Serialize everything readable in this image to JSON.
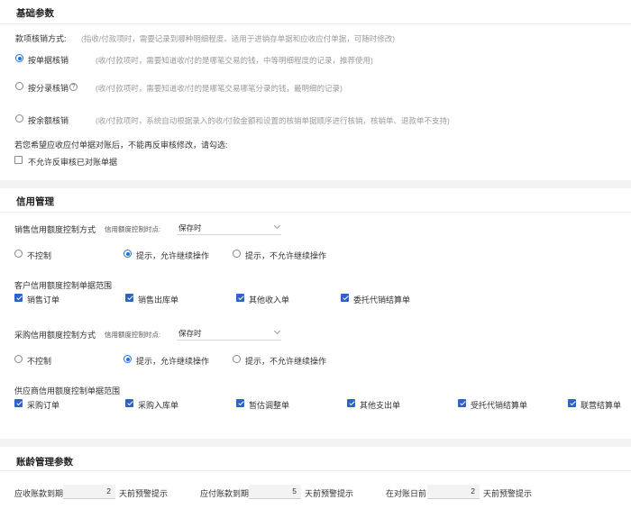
{
  "basic": {
    "title": "基础参数",
    "method_label": "款项核销方式:",
    "method_hint": "(指收/付款项时，需要记录到哪种明细程度。适用于进销存单据和应收应付单据，可随时修改)",
    "options": [
      {
        "label": "按单据核销",
        "desc": "(收/付款项时，需要知道收/付的是哪笔交易的钱，中等明细程度的记录，推荐使用)",
        "selected": true
      },
      {
        "label": "按分录核销",
        "desc": "(收/付款项时，需要知道收/付的是哪笔交易哪笔分录的钱，最明细的记录)",
        "selected": false
      },
      {
        "label": "按余额核销",
        "desc": "(收/付款项时，系统自动根据录入的收/付款金额和设置的核销单据顺序进行核销，核销单、退款单不支持)",
        "selected": false
      }
    ],
    "notice": "若您希望应收应付单据对账后，不能再反审核修改，请勾选:",
    "lock_label": "不允许反审核已对账单据",
    "help_glyph": "?"
  },
  "credit": {
    "title": "信用管理",
    "sales": {
      "label": "销售信用额度控制方式",
      "point_label": "信用额度控制时点:",
      "point_value": "保存时",
      "options": [
        {
          "label": "不控制",
          "selected": false
        },
        {
          "label": "提示，允许继续操作",
          "selected": true
        },
        {
          "label": "提示，不允许继续操作",
          "selected": false
        }
      ],
      "scope_label": "客户信用额度控制单据范围",
      "docs": [
        {
          "label": "销售订单",
          "checked": true
        },
        {
          "label": "销售出库单",
          "checked": true
        },
        {
          "label": "其他收入单",
          "checked": true
        },
        {
          "label": "委托代销结算单",
          "checked": true
        }
      ]
    },
    "purchase": {
      "label": "采购信用额度控制方式",
      "point_label": "信用额度控制时点:",
      "point_value": "保存时",
      "options": [
        {
          "label": "不控制",
          "selected": false
        },
        {
          "label": "提示，允许继续操作",
          "selected": true
        },
        {
          "label": "提示，不允许继续操作",
          "selected": false
        }
      ],
      "scope_label": "供应商信用额度控制单据范围",
      "docs": [
        {
          "label": "采购订单",
          "checked": true
        },
        {
          "label": "采购入库单",
          "checked": true
        },
        {
          "label": "暂估调整单",
          "checked": true
        },
        {
          "label": "其他支出单",
          "checked": true
        },
        {
          "label": "受托代销结算单",
          "checked": true
        },
        {
          "label": "联营结算单",
          "checked": true
        }
      ]
    }
  },
  "aging": {
    "title": "账龄管理参数",
    "items": [
      {
        "label": "应收账款到期",
        "value": "2",
        "suffix": "天前预警提示"
      },
      {
        "label": "应付账款到期",
        "value": "5",
        "suffix": "天前预警提示"
      },
      {
        "label": "在对账日前",
        "value": "2",
        "suffix": "天前预警提示"
      }
    ]
  }
}
